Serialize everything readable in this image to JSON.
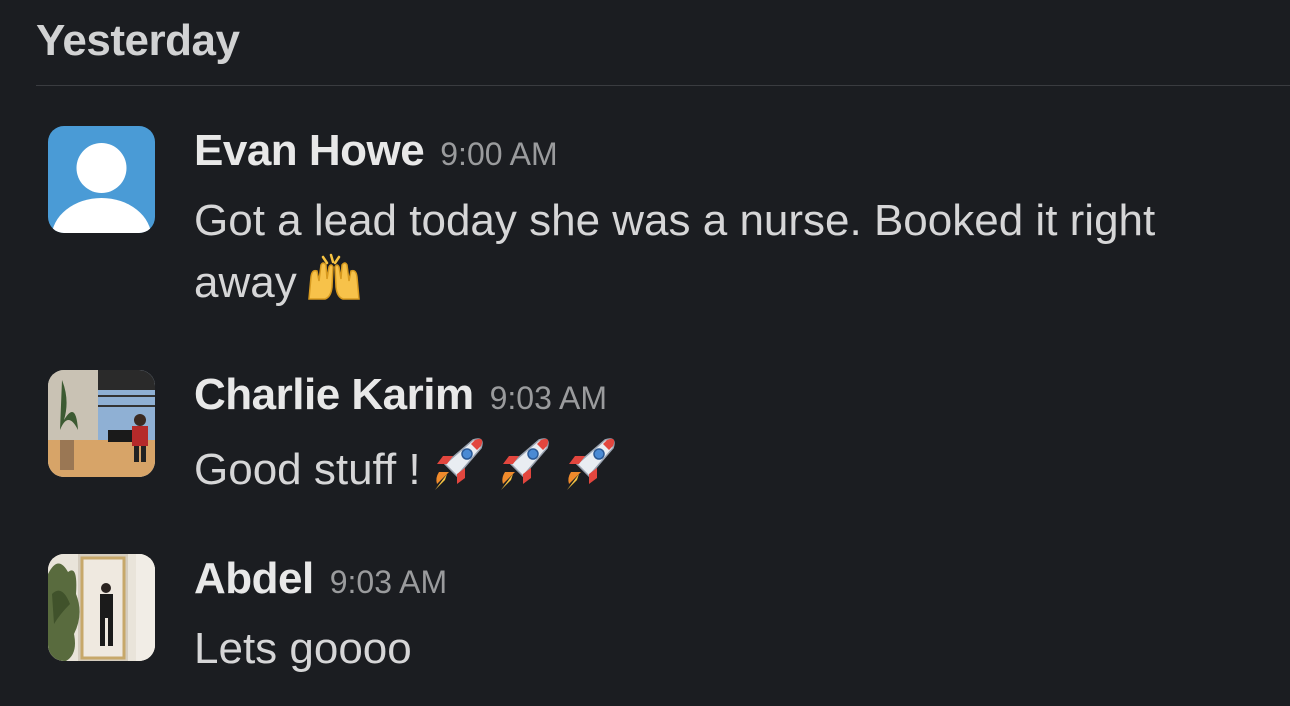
{
  "section": {
    "date_label": "Yesterday"
  },
  "messages": [
    {
      "author": "Evan Howe",
      "time": "9:00 AM",
      "text": "Got a lead today she was a nurse. Booked it right away",
      "emoji": "raised-hands",
      "avatar": "default-person-avatar"
    },
    {
      "author": "Charlie Karim",
      "time": "9:03 AM",
      "text": "Good stuff !",
      "emoji": "rocket x3",
      "avatar": "photo-avatar-office"
    },
    {
      "author": "Abdel",
      "time": "9:03 AM",
      "text": "Lets goooo",
      "avatar": "photo-avatar-mirror"
    }
  ],
  "colors": {
    "background": "#1b1d21",
    "text": "#d1d2d3",
    "timestamp": "#9a9b9d",
    "default_avatar_bg": "#4a9bd6"
  }
}
